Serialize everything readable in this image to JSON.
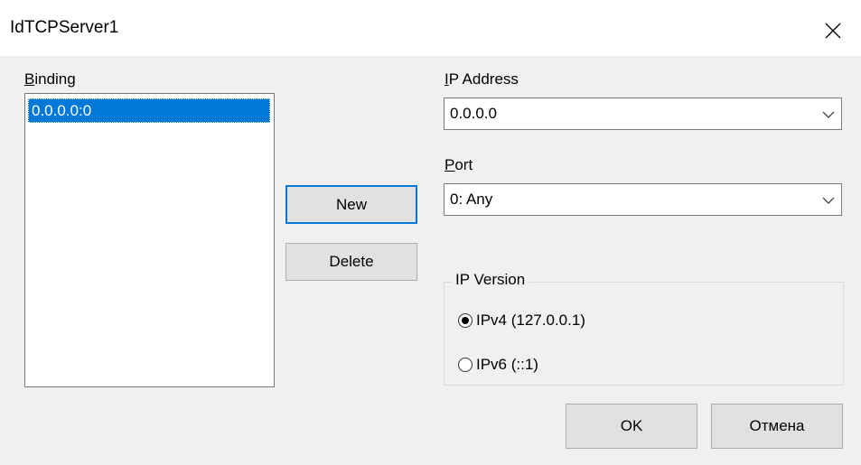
{
  "window": {
    "title": "IdTCPServer1",
    "close_icon": "close-icon"
  },
  "binding": {
    "label_mnemonic": "B",
    "label_rest": "inding",
    "items": [
      "0.0.0.0:0"
    ],
    "selected_index": 0
  },
  "buttons": {
    "new_label": "New",
    "delete_label": "Delete",
    "ok_label": "OK",
    "cancel_label": "Отмена"
  },
  "ip_address": {
    "label_mnemonic": "I",
    "label_rest": "P Address",
    "value": "0.0.0.0"
  },
  "port": {
    "label_mnemonic": "P",
    "label_rest": "ort",
    "value": "0: Any"
  },
  "ip_version": {
    "legend": "IP Version",
    "options": [
      {
        "label": "IPv4 (127.0.0.1)",
        "checked": true
      },
      {
        "label": "IPv6 (::1)",
        "checked": false
      }
    ]
  },
  "colors": {
    "selection": "#0078d7",
    "dialog_bg": "#f0f0f0",
    "title_bg": "#ffffff"
  }
}
